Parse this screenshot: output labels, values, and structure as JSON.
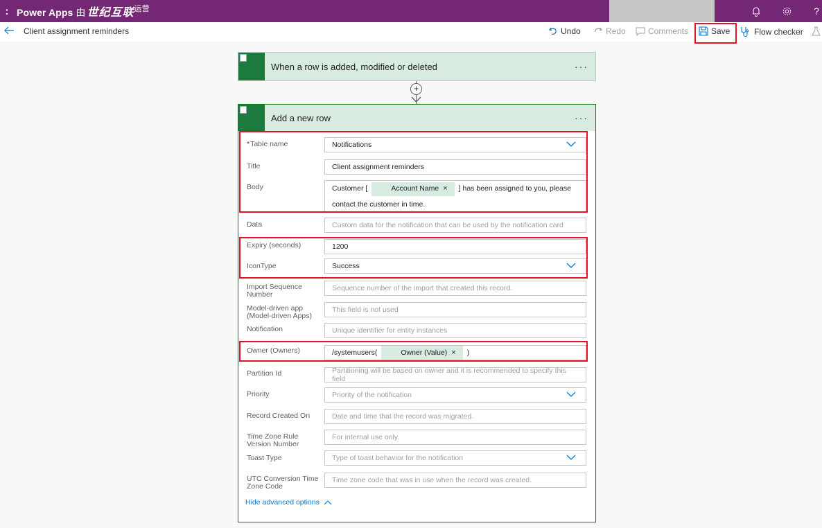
{
  "topbar": {
    "waffle": ":",
    "brand": "Power Apps",
    "brand_by": "由",
    "brand_logo": "世纪互联",
    "brand_ops": "运营",
    "colors": {
      "bar": "#742774",
      "text": "#ffffff"
    },
    "icons": [
      "notification-bell-icon",
      "settings-gear-icon",
      "help-icon"
    ]
  },
  "commandbar": {
    "flow_title": "Client assignment reminders",
    "undo": "Undo",
    "redo": "Redo",
    "comments": "Comments",
    "save": "Save",
    "flow_checker": "Flow checker"
  },
  "trigger": {
    "title": "When a row is added, modified or deleted",
    "more": "···"
  },
  "action": {
    "title": "Add a new row",
    "more": "···",
    "fields": {
      "table_name": {
        "label": "Table name",
        "value": "Notifications",
        "required": "*"
      },
      "title": {
        "label": "Title",
        "value": "Client assignment reminders"
      },
      "body": {
        "label": "Body",
        "prefix": "Customer [",
        "token": "Account Name",
        "suffix": "] has been assigned to you, please",
        "line2": "contact the customer in time."
      },
      "data": {
        "label": "Data",
        "placeholder": "Custom data for the notification that can be used by the notification card"
      },
      "expiry": {
        "label": "Expiry (seconds)",
        "value": "1200"
      },
      "icon_type": {
        "label": "IconType",
        "value": "Success"
      },
      "import_seq": {
        "label": "Import Sequence Number",
        "placeholder": "Sequence number of the import that created this record."
      },
      "model_app": {
        "label": "Model-driven app (Model-driven Apps)",
        "placeholder": "This field is not used"
      },
      "notification": {
        "label": "Notification",
        "placeholder": "Unique identifier for entity instances"
      },
      "owner": {
        "label": "Owner (Owners)",
        "prefix": "/systemusers(",
        "token": "Owner (Value)",
        "suffix": ")"
      },
      "partition": {
        "label": "Partition Id",
        "placeholder": "Partitioning will be based on owner and it is recommended to specify this field"
      },
      "priority": {
        "label": "Priority",
        "placeholder": "Priority of the notification"
      },
      "record_created": {
        "label": "Record Created On",
        "placeholder": "Date and time that the record was migrated."
      },
      "tz_rule": {
        "label": "Time Zone Rule Version Number",
        "placeholder": "For internal use only."
      },
      "toast_type": {
        "label": "Toast Type",
        "placeholder": "Type of toast behavior for the notification"
      },
      "utc_conv": {
        "label": "UTC Conversion Time Zone Code",
        "placeholder": "Time zone code that was in use when the record was created."
      }
    },
    "hide_advanced": "Hide advanced options"
  }
}
